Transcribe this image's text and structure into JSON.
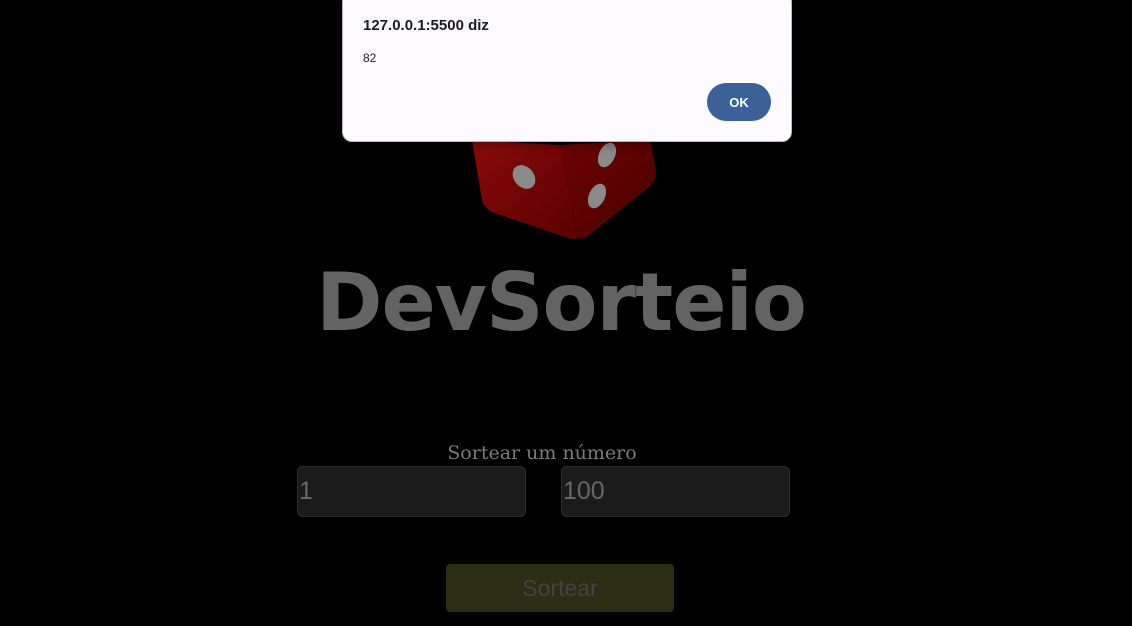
{
  "app": {
    "title": "DevSorteio",
    "subtitle": "Sortear um número"
  },
  "logo": {
    "icon": "dice-icon",
    "color": "#6b0000"
  },
  "inputs": {
    "min_value": "1",
    "max_value": "100"
  },
  "draw_button": {
    "label": "Sortear",
    "color": "#2b2d14"
  },
  "alert": {
    "title": "127.0.0.1:5500 diz",
    "message": "82",
    "ok_label": "OK",
    "ok_color": "#3b6198"
  }
}
